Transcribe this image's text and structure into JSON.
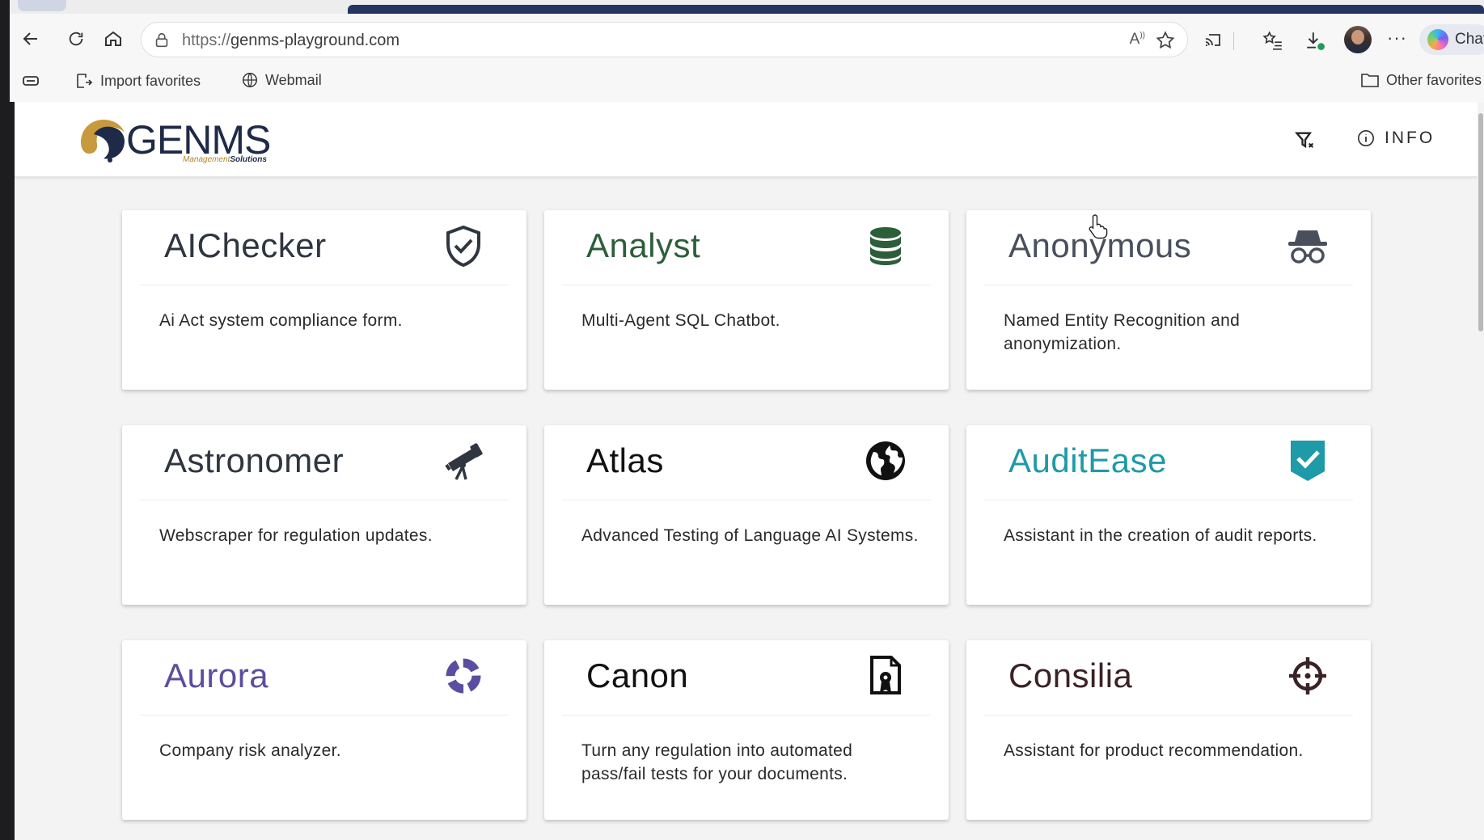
{
  "browser": {
    "url_scheme": "https://",
    "url_host": "genms-playground.com",
    "copilot_label": "Chat",
    "favorites": {
      "import": "Import favorites",
      "webmail": "Webmail",
      "other": "Other favorites"
    }
  },
  "header": {
    "logo_text_bold": "GEN",
    "logo_text_thin": "MS",
    "logo_sub_a": "Management",
    "logo_sub_b": "Solutions",
    "info_label": "INFO"
  },
  "cards": [
    {
      "title": "AIChecker",
      "description": "Ai Act system compliance form.",
      "icon": "shield-check-icon",
      "color": "#2f3640"
    },
    {
      "title": "Analyst",
      "description": "Multi-Agent SQL Chatbot.",
      "icon": "database-icon",
      "color": "#2c5e3a"
    },
    {
      "title": "Anonymous",
      "description": "Named Entity Recognition and anonymization.",
      "icon": "incognito-icon",
      "color": "#4a4f5c"
    },
    {
      "title": "Astronomer",
      "description": "Webscraper for regulation updates.",
      "icon": "telescope-icon",
      "color": "#2f3640"
    },
    {
      "title": "Atlas",
      "description": "Advanced Testing of Language AI Systems.",
      "icon": "globe-icon",
      "color": "#111111"
    },
    {
      "title": "AuditEase",
      "description": "Assistant in the creation of audit reports.",
      "icon": "check-badge-icon",
      "color": "#1e9aa8"
    },
    {
      "title": "Aurora",
      "description": "Company risk analyzer.",
      "icon": "aurora-ring-icon",
      "color": "#5b4ea0"
    },
    {
      "title": "Canon",
      "description": "Turn any regulation into automated pass/fail tests for your documents.",
      "icon": "certificate-file-icon",
      "color": "#111111"
    },
    {
      "title": "Consilia",
      "description": "Assistant for product recommendation.",
      "icon": "crosshair-icon",
      "color": "#3b2226"
    }
  ]
}
